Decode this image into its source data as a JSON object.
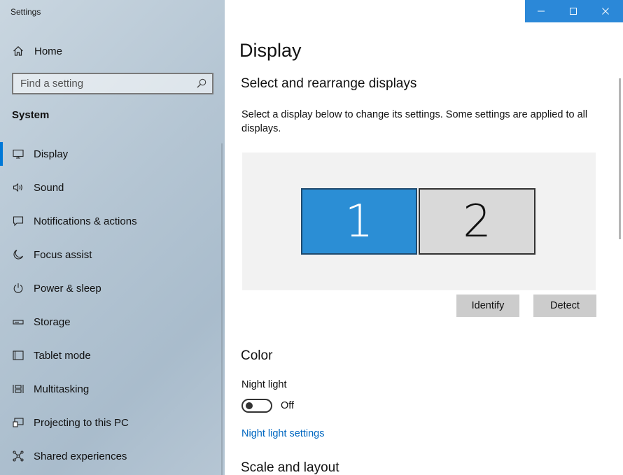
{
  "window": {
    "app_title": "Settings",
    "accent": "#0078d7"
  },
  "sidebar": {
    "home_label": "Home",
    "search": {
      "placeholder": "Find a setting"
    },
    "section_label": "System",
    "items": [
      {
        "label": "Display",
        "icon": "monitor-icon",
        "active": true
      },
      {
        "label": "Sound",
        "icon": "speaker-icon"
      },
      {
        "label": "Notifications & actions",
        "icon": "message-icon"
      },
      {
        "label": "Focus assist",
        "icon": "moon-icon"
      },
      {
        "label": "Power & sleep",
        "icon": "power-icon"
      },
      {
        "label": "Storage",
        "icon": "storage-icon"
      },
      {
        "label": "Tablet mode",
        "icon": "tablet-icon"
      },
      {
        "label": "Multitasking",
        "icon": "multitasking-icon"
      },
      {
        "label": "Projecting to this PC",
        "icon": "projecting-icon"
      },
      {
        "label": "Shared experiences",
        "icon": "share-icon"
      }
    ]
  },
  "main": {
    "title": "Display",
    "arrange": {
      "heading": "Select and rearrange displays",
      "description": "Select a display below to change its settings. Some settings are applied to all displays.",
      "monitors": [
        {
          "number": "1",
          "selected": true,
          "color": "#2b8ed5"
        },
        {
          "number": "2",
          "selected": false,
          "color": "#d9d9d9"
        }
      ],
      "identify_label": "Identify",
      "detect_label": "Detect"
    },
    "color": {
      "heading": "Color",
      "night_light_label": "Night light",
      "night_light_state": "Off",
      "night_light_on": false,
      "night_light_link": "Night light settings"
    },
    "scale_heading": "Scale and layout"
  }
}
